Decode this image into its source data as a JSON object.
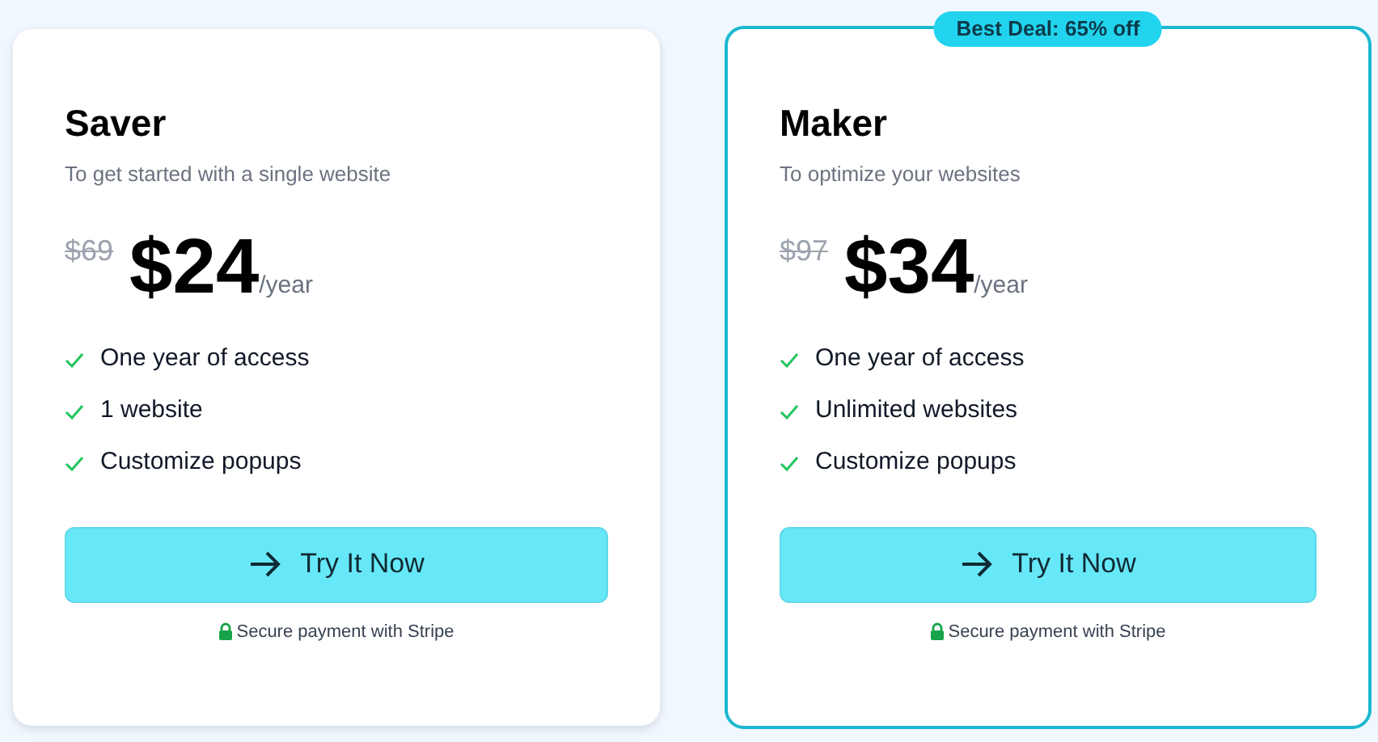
{
  "plans": [
    {
      "name": "Saver",
      "subtitle": "To get started with a single website",
      "old_price": "$69",
      "price": "$24",
      "period": "/year",
      "features": [
        "One year of access",
        "1 website",
        "Customize popups"
      ],
      "button": "Try It Now",
      "note": "Secure payment with Stripe",
      "featured": false
    },
    {
      "name": "Maker",
      "subtitle": "To optimize your websites",
      "old_price": "$97",
      "price": "$34",
      "period": "/year",
      "features": [
        "One year of access",
        "Unlimited websites",
        "Customize popups"
      ],
      "button": "Try It Now",
      "note": "Secure payment with Stripe",
      "featured": true,
      "badge": "Best Deal: 65% off"
    }
  ]
}
